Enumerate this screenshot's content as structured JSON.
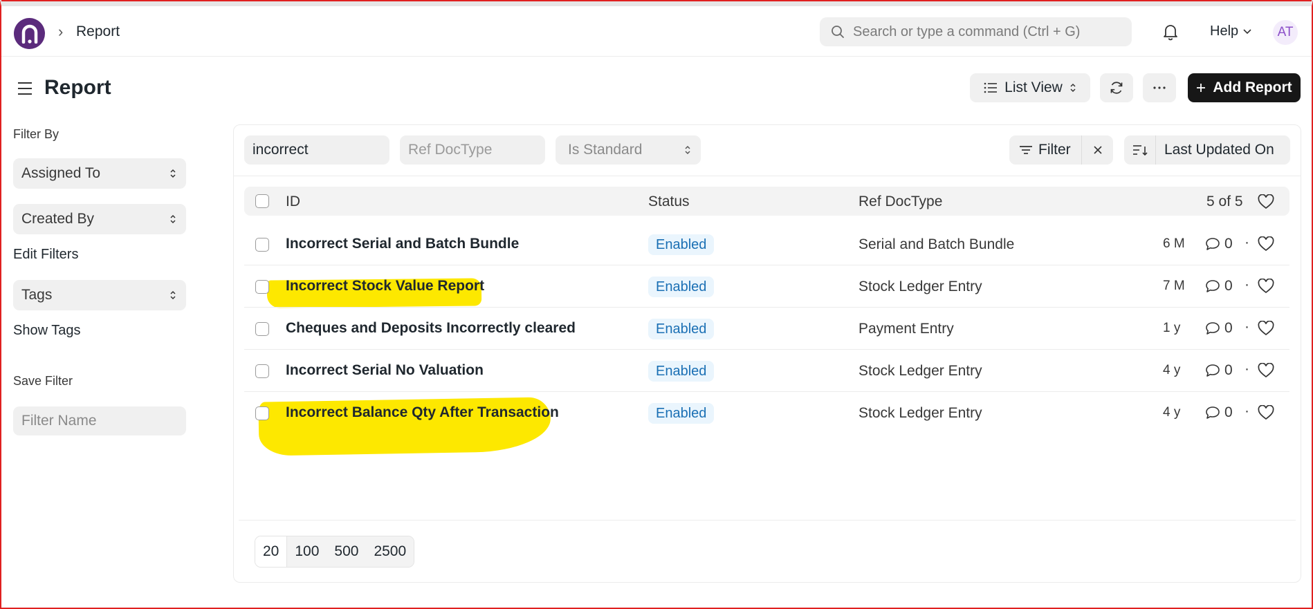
{
  "navbar": {
    "breadcrumb": "Report",
    "search_placeholder": "Search or type a command (Ctrl + G)",
    "help_label": "Help",
    "avatar_initials": "AT"
  },
  "header": {
    "title": "Report",
    "list_view_label": "List View",
    "add_label": "Add Report"
  },
  "sidebar": {
    "filter_by": "Filter By",
    "assigned_to": "Assigned To",
    "created_by": "Created By",
    "edit_filters": "Edit Filters",
    "tags": "Tags",
    "show_tags": "Show Tags",
    "save_filter": "Save Filter",
    "filter_name_placeholder": "Filter Name"
  },
  "filters": {
    "search_value": "incorrect",
    "ref_doctype_placeholder": "Ref DocType",
    "is_standard_placeholder": "Is Standard",
    "filter_label": "Filter",
    "sort_label": "Last Updated On"
  },
  "list": {
    "columns": {
      "id": "ID",
      "status": "Status",
      "ref_doctype": "Ref DocType"
    },
    "count": "5 of 5",
    "rows": [
      {
        "id": "Incorrect Serial and Batch Bundle",
        "status": "Enabled",
        "ref_doctype": "Serial and Batch Bundle",
        "age": "6 M",
        "comments": "0",
        "highlighted": false
      },
      {
        "id": "Incorrect Stock Value Report",
        "status": "Enabled",
        "ref_doctype": "Stock Ledger Entry",
        "age": "7 M",
        "comments": "0",
        "highlighted": true
      },
      {
        "id": "Cheques and Deposits Incorrectly cleared",
        "status": "Enabled",
        "ref_doctype": "Payment Entry",
        "age": "1 y",
        "comments": "0",
        "highlighted": false
      },
      {
        "id": "Incorrect Serial No Valuation",
        "status": "Enabled",
        "ref_doctype": "Stock Ledger Entry",
        "age": "4 y",
        "comments": "0",
        "highlighted": false
      },
      {
        "id": "Incorrect Balance Qty After Transaction",
        "status": "Enabled",
        "ref_doctype": "Stock Ledger Entry",
        "age": "4 y",
        "comments": "0",
        "highlighted": true
      }
    ]
  },
  "paging": {
    "sizes": [
      "20",
      "100",
      "500",
      "2500"
    ],
    "selected": "20"
  },
  "colors": {
    "brand": "#5b2b7c",
    "primary_button": "#171717",
    "status_badge_bg": "#eaf5fd",
    "status_badge_text": "#1a6fb4",
    "highlight": "#fde800",
    "frame_border": "#e02020"
  }
}
